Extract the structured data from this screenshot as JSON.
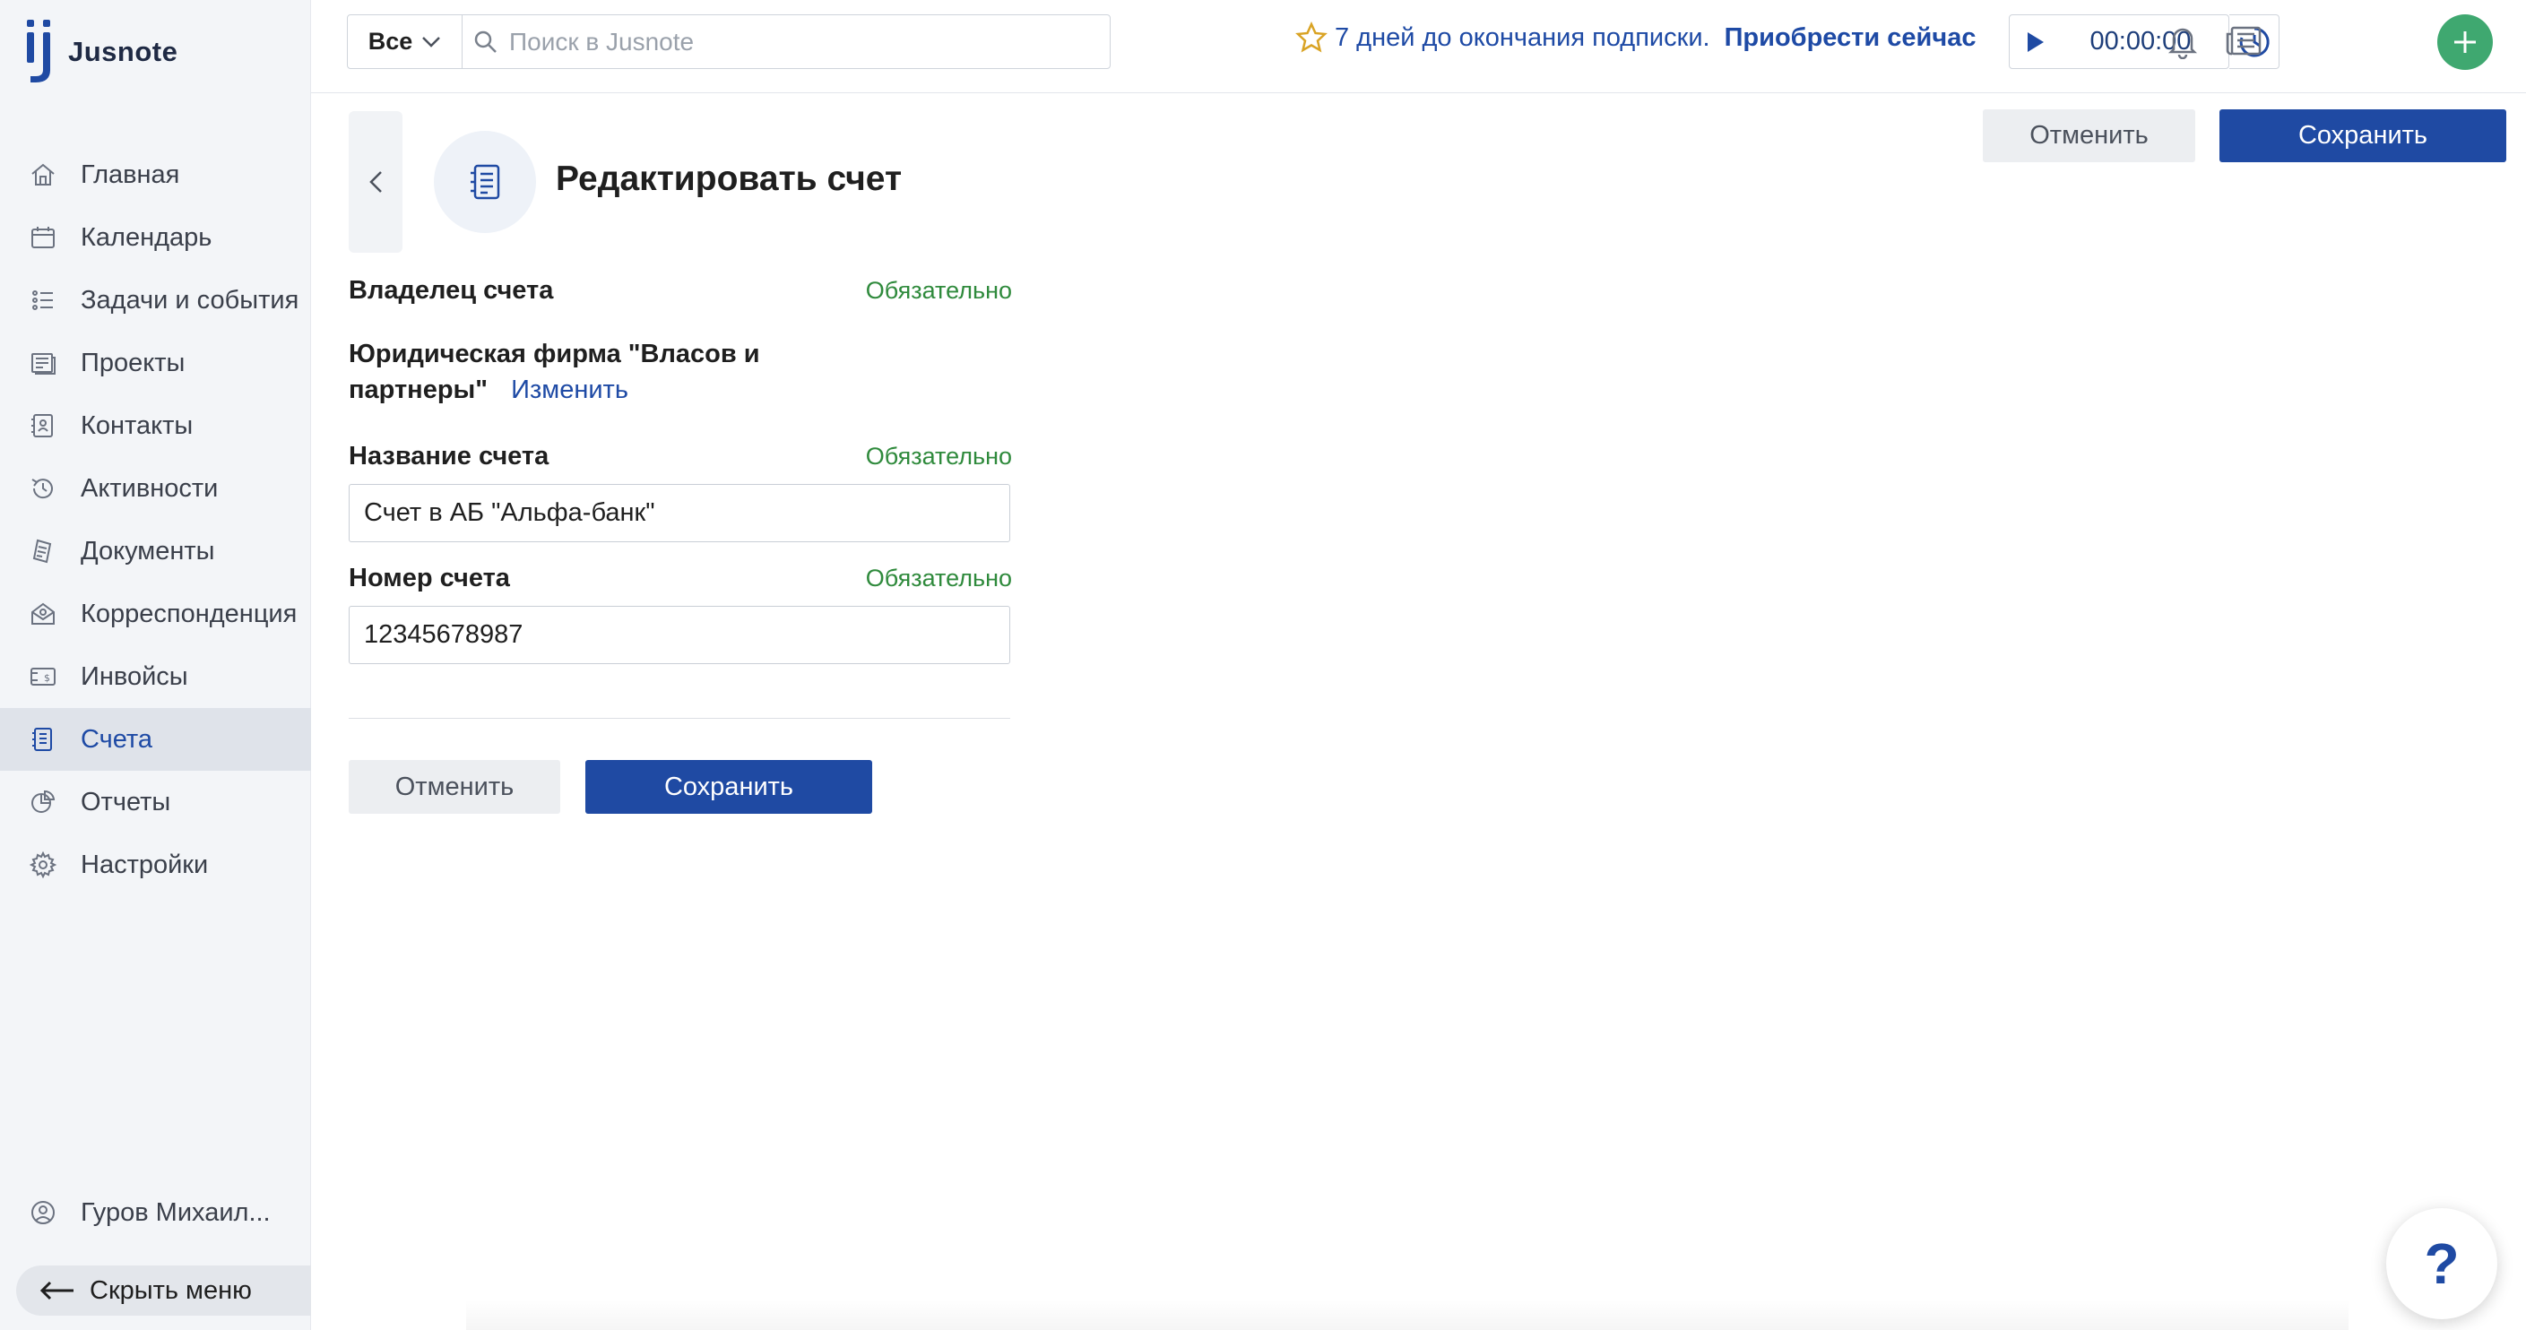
{
  "app": {
    "name": "Jusnote"
  },
  "sidebar": {
    "items": [
      {
        "label": "Главная",
        "icon": "home-icon"
      },
      {
        "label": "Календарь",
        "icon": "calendar-icon"
      },
      {
        "label": "Задачи и события",
        "icon": "tasks-icon"
      },
      {
        "label": "Проекты",
        "icon": "projects-icon"
      },
      {
        "label": "Контакты",
        "icon": "contacts-icon"
      },
      {
        "label": "Активности",
        "icon": "activity-icon"
      },
      {
        "label": "Документы",
        "icon": "documents-icon"
      },
      {
        "label": "Корреспонденция",
        "icon": "mail-icon"
      },
      {
        "label": "Инвойсы",
        "icon": "invoice-icon"
      },
      {
        "label": "Счета",
        "icon": "accounts-icon",
        "active": true
      },
      {
        "label": "Отчеты",
        "icon": "reports-icon"
      },
      {
        "label": "Настройки",
        "icon": "settings-icon"
      }
    ],
    "user": "Гуров Михаил...",
    "hide_menu": "Скрыть меню"
  },
  "topbar": {
    "scope": "Все",
    "search_placeholder": "Поиск в Jusnote",
    "subscription_text": "7 дней до окончания подписки.",
    "subscription_link": "Приобрести сейчас",
    "timer": "00:00:00"
  },
  "header": {
    "title": "Редактировать счет",
    "cancel_label": "Отменить",
    "save_label": "Сохранить"
  },
  "form": {
    "owner_label": "Владелец счета",
    "required": "Обязательно",
    "owner_value": "Юридическая фирма \"Власов и партнеры\"",
    "owner_change": "Изменить",
    "name_label": "Название счета",
    "name_value": "Счет в АБ \"Альфа-банк\"",
    "number_label": "Номер счета",
    "number_value": "12345678987",
    "cancel_label": "Отменить",
    "save_label": "Сохранить"
  },
  "help": {
    "label": "?"
  },
  "colors": {
    "accent": "#1f4aa3",
    "required": "#2f8a3c",
    "add": "#3fa870"
  }
}
